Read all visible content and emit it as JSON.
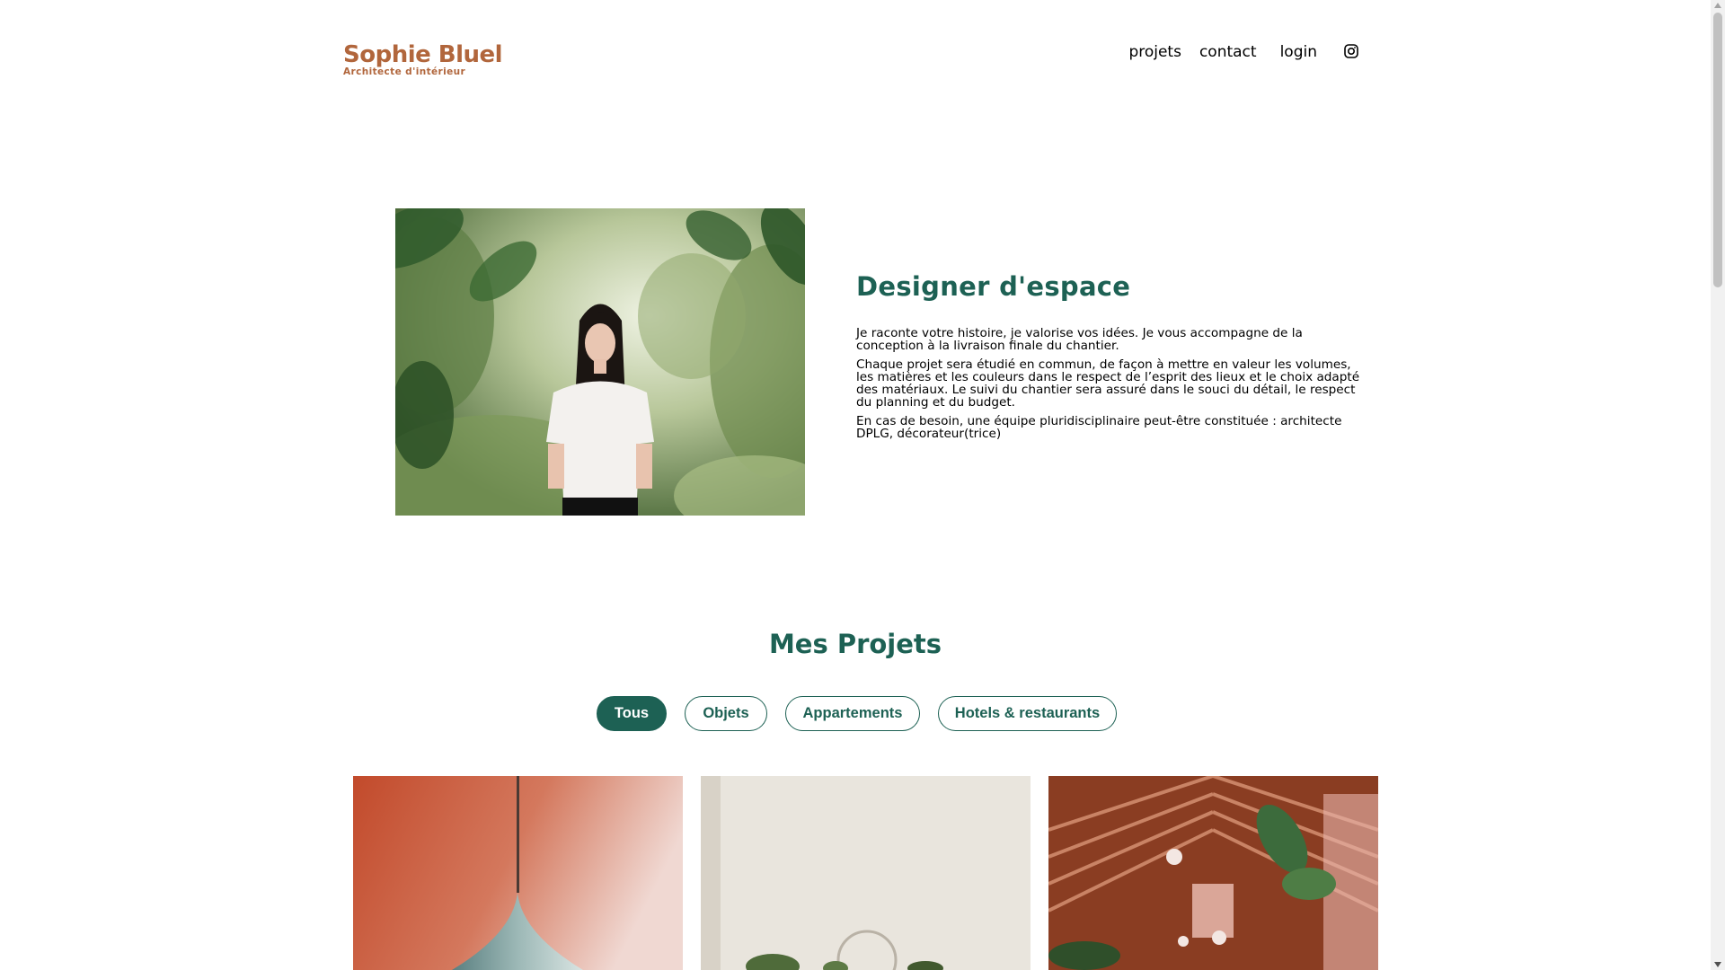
{
  "header": {
    "logo_title": "Sophie Bluel",
    "logo_subtitle": "Architecte d'intérieur",
    "nav": [
      "projets",
      "contact",
      "login"
    ],
    "instagram_icon": "instagram-icon"
  },
  "intro": {
    "title": "Designer d'espace",
    "paragraphs": [
      "Je raconte votre histoire, je valorise vos idées. Je vous accompagne de la conception à la livraison finale du chantier.",
      "Chaque projet sera étudié en commun, de façon à mettre en valeur les volumes, les matières et les couleurs dans le respect de l’esprit des lieux et le choix adapté des matériaux. Le suivi du chantier sera assuré dans le souci du détail, le respect du planning et du budget.",
      "En cas de besoin, une équipe pluridisciplinaire peut-être constituée : architecte DPLG, décorateur(trice)"
    ]
  },
  "projects": {
    "title": "Mes Projets",
    "filters": [
      "Tous",
      "Objets",
      "Appartements",
      "Hotels & restaurants"
    ],
    "active_filter": "Tous"
  },
  "colors": {
    "brand": "#B1663C",
    "accent": "#1D6154"
  }
}
